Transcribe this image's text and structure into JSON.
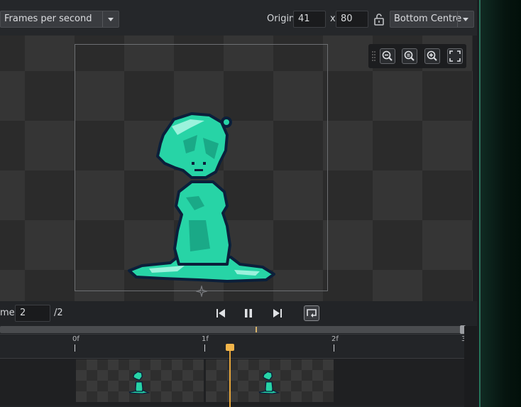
{
  "toolbar": {
    "speed_mode": "Frames per second",
    "origin_label": "Origin",
    "origin_x": "41",
    "x_sep": "x",
    "origin_y": "80",
    "origin_preset": "Bottom Centre"
  },
  "zoom_controls": [
    "zoom-out-icon",
    "zoom-reset-icon",
    "zoom-in-icon",
    "fit-icon"
  ],
  "playback": {
    "frame_label": "me:",
    "frame_value": "2",
    "frame_total": "/2"
  },
  "timeline": {
    "ticks": [
      "0f",
      "1f",
      "2f",
      "3"
    ],
    "frame_count": 2
  },
  "colors": {
    "accent": "#e6a53a",
    "sprite": "#27d4a6",
    "sprite_outline": "#0b1f3a",
    "side_glow": "#2fbf8a"
  }
}
